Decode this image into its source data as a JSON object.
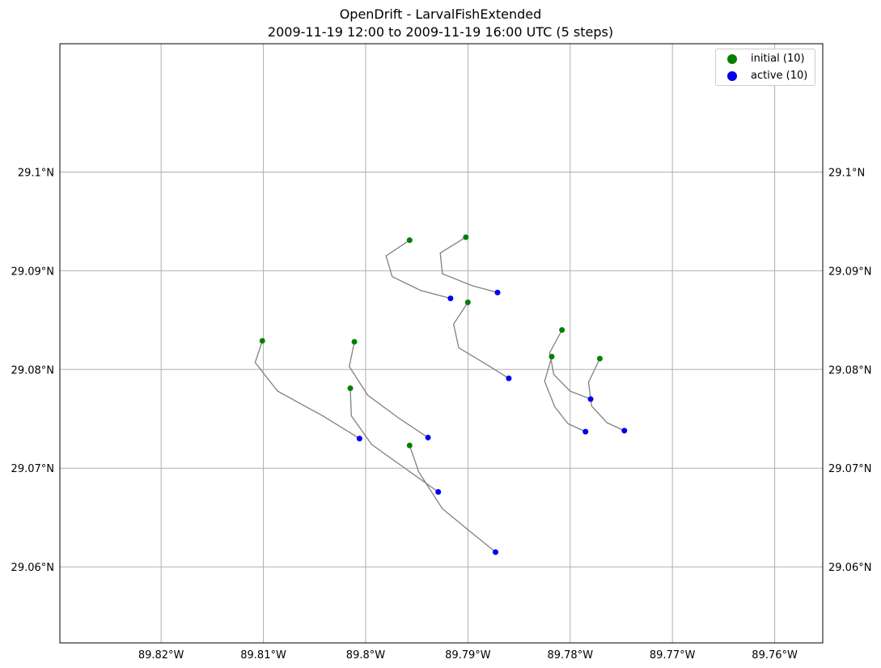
{
  "title": {
    "line1": "OpenDrift - LarvalFishExtended",
    "line2": "2009-11-19 12:00 to 2009-11-19 16:00 UTC (5 steps)"
  },
  "legend": {
    "initial_label": "initial (10)",
    "active_label": "active (10)"
  },
  "colors": {
    "initial": "#008000",
    "active": "#0000ee",
    "trajectory": "#808080",
    "grid": "#b0b0b0"
  },
  "chart_data": {
    "type": "scatter",
    "xlim": [
      -89.8299,
      -89.7553
    ],
    "ylim": [
      29.0523,
      29.0131
    ],
    "ylim_note": "",
    "x_ticks": [
      {
        "value": -89.82,
        "label": "89.82°W"
      },
      {
        "value": -89.81,
        "label": "89.81°W"
      },
      {
        "value": -89.8,
        "label": "89.8°W"
      },
      {
        "value": -89.79,
        "label": "89.79°W"
      },
      {
        "value": -89.78,
        "label": "89.78°W"
      },
      {
        "value": -89.77,
        "label": "89.77°W"
      },
      {
        "value": -89.76,
        "label": "89.76°W"
      }
    ],
    "y_ticks": [
      {
        "value": 29.1,
        "label": "29.1°N"
      },
      {
        "value": 29.09,
        "label": "29.09°N"
      },
      {
        "value": 29.08,
        "label": "29.08°N"
      },
      {
        "value": 29.07,
        "label": "29.07°N"
      },
      {
        "value": 29.06,
        "label": "29.06°N"
      }
    ],
    "grid": true,
    "legend_position": "top-right",
    "trajectories": [
      {
        "lon": [
          -89.7957,
          -89.798,
          -89.7974,
          -89.7946,
          -89.7917
        ],
        "lat": [
          29.0931,
          29.0915,
          29.0894,
          29.088,
          29.0872
        ]
      },
      {
        "lon": [
          -89.7902,
          -89.7927,
          -89.7925,
          -89.7896,
          -89.7871
        ],
        "lat": [
          29.0934,
          29.0918,
          29.0897,
          29.0885,
          29.0878
        ]
      },
      {
        "lon": [
          -89.79,
          -89.7914,
          -89.7909,
          -89.788,
          -89.786
        ],
        "lat": [
          29.0868,
          29.0846,
          29.0822,
          29.0804,
          29.0791
        ]
      },
      {
        "lon": [
          -89.8101,
          -89.8108,
          -89.8086,
          -89.8042,
          -89.8006
        ],
        "lat": [
          29.0829,
          29.0807,
          29.0778,
          29.0753,
          29.073
        ]
      },
      {
        "lon": [
          -89.8011,
          -89.8016,
          -89.7998,
          -89.7968,
          -89.7939
        ],
        "lat": [
          29.0828,
          29.0803,
          29.0774,
          29.0751,
          29.0731
        ]
      },
      {
        "lon": [
          -89.8015,
          -89.8014,
          -89.7994,
          -89.7963,
          -89.7929
        ],
        "lat": [
          29.0781,
          29.0753,
          29.0724,
          29.0701,
          29.0676
        ]
      },
      {
        "lon": [
          -89.7957,
          -89.7948,
          -89.7925,
          -89.7898,
          -89.7873
        ],
        "lat": [
          29.0723,
          29.0696,
          29.0659,
          29.0636,
          29.0615
        ]
      },
      {
        "lon": [
          -89.7808,
          -89.782,
          -89.7816,
          -89.78,
          -89.778
        ],
        "lat": [
          29.084,
          29.0817,
          29.0795,
          29.0778,
          29.077
        ]
      },
      {
        "lon": [
          -89.7818,
          -89.7825,
          -89.7815,
          -89.7802,
          -89.7785
        ],
        "lat": [
          29.0813,
          29.0788,
          29.0762,
          29.0745,
          29.0737
        ]
      },
      {
        "lon": [
          -89.7771,
          -89.7782,
          -89.7779,
          -89.7764,
          -89.7747
        ],
        "lat": [
          29.0811,
          29.0787,
          29.0763,
          29.0746,
          29.0738
        ]
      }
    ]
  }
}
